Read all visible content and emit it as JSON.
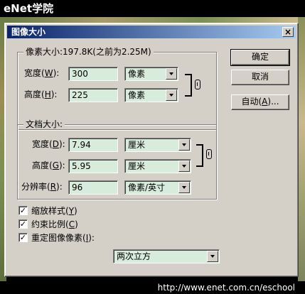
{
  "watermark": {
    "brand": "eNet学院",
    "url": "http://www.enet.com.cn/eschool"
  },
  "dialog": {
    "title": "图像大小",
    "close_glyph": "×",
    "pixel_dims": {
      "label": "像素大小:197.8K(之前为2.25M)",
      "width": {
        "label": "宽度(",
        "hotkey": "W",
        "tail": "):",
        "value": "300",
        "unit": "像素"
      },
      "height": {
        "label": "高度(",
        "hotkey": "H",
        "tail": "):",
        "value": "225",
        "unit": "像素"
      }
    },
    "doc_size": {
      "label": "文档大小:",
      "width": {
        "label": "宽度(",
        "hotkey": "D",
        "tail": "):",
        "value": "7.94",
        "unit": "厘米"
      },
      "height": {
        "label": "高度(",
        "hotkey": "G",
        "tail": "):",
        "value": "5.95",
        "unit": "厘米"
      },
      "resolution": {
        "label": "分辨率(",
        "hotkey": "R",
        "tail": "):",
        "value": "96",
        "unit": "像素/英寸"
      }
    },
    "buttons": {
      "ok": "确定",
      "cancel": "取消",
      "auto": {
        "label": "自动(",
        "hotkey": "A",
        "tail": ")..."
      }
    },
    "options": {
      "scale_styles": {
        "label": "缩放样式(",
        "hotkey": "Y",
        "tail": ")",
        "checked": true
      },
      "constrain": {
        "label": "约束比例(",
        "hotkey": "C",
        "tail": ")",
        "checked": true
      },
      "resample": {
        "label": "重定图像像素(",
        "hotkey": "I",
        "tail": "):",
        "checked": true
      },
      "method": "两次立方"
    },
    "check_glyph": "✓"
  }
}
